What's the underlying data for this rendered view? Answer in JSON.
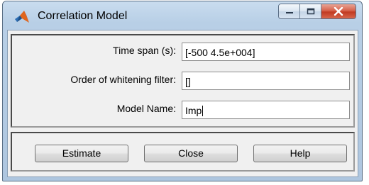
{
  "window": {
    "title": "Correlation Model",
    "caption_buttons": [
      "minimize-icon",
      "maximize-icon",
      "close-icon"
    ]
  },
  "form": {
    "time_span": {
      "label": "Time span (s):",
      "value": "[-500 4.5e+004]"
    },
    "whitening_order": {
      "label": "Order of whitening filter:",
      "value": "[]"
    },
    "model_name": {
      "label": "Model Name:",
      "value": "Imp"
    }
  },
  "buttons": {
    "estimate": "Estimate",
    "close": "Close",
    "help": "Help"
  },
  "colors": {
    "title_bar": "#b8cfe6",
    "client_bg": "#f0f0f0",
    "close_button": "#c13a22"
  }
}
